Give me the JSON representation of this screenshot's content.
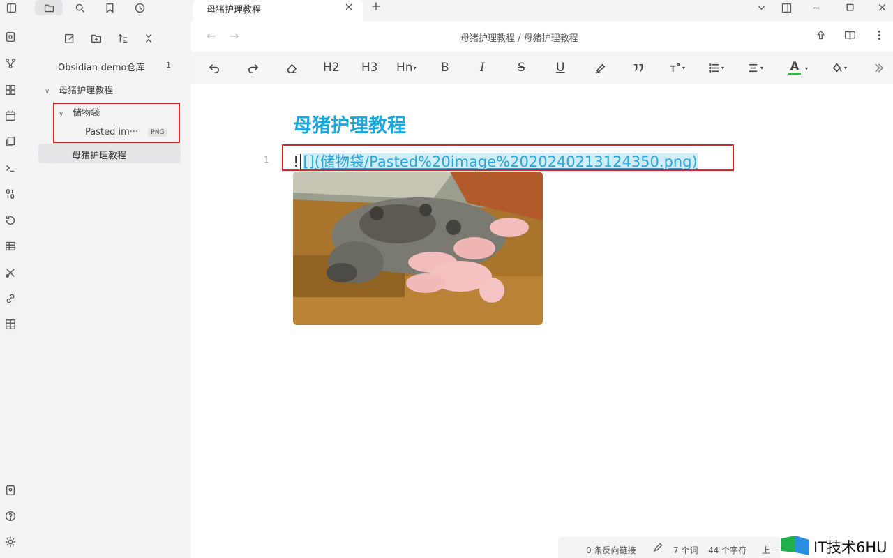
{
  "titlebar": {
    "tab_title": "母猪护理教程",
    "icons": [
      "sidebar-toggle-icon",
      "folder-icon",
      "search-icon",
      "bookmark-icon",
      "clock-icon",
      "close-icon",
      "plus-icon",
      "chevron-down-icon",
      "split-view-icon",
      "minimize-icon",
      "maximize-icon",
      "window-close-icon"
    ]
  },
  "ribbon": {
    "icons": [
      "vault-switch-icon",
      "graph-icon",
      "canvas-icon",
      "calendar-icon",
      "files-icon",
      "terminal-icon",
      "binary-icon",
      "history-icon",
      "table-icon",
      "tools-icon",
      "link-icon",
      "grid-icon",
      "help-vault-icon",
      "help-icon",
      "settings-icon"
    ]
  },
  "sidebar": {
    "vault_name": "Obsidian-demo仓库",
    "vault_count": "1",
    "folder": "母猪护理教程",
    "subfolder": "储物袋",
    "attachment_name": "Pasted im···",
    "attachment_badge": "PNG",
    "active_file": "母猪护理教程"
  },
  "editor": {
    "breadcrumb": "母猪护理教程 / 母猪护理教程",
    "toolbar": {
      "h2": "H2",
      "h3": "H3",
      "hn": "Hn",
      "bold": "B",
      "italic": "I",
      "strike": "S",
      "underline": "U",
      "text_color": "A"
    },
    "note_title": "母猪护理教程",
    "line_number": "1",
    "embed_prefix": "!",
    "embed_link": "[](储物袋/Pasted%20image%2020240213124350.png)"
  },
  "statusbar": {
    "backlinks": "0 条反向链接",
    "words": "7 个词",
    "chars": "44 个字符",
    "extra": "上一"
  },
  "watermark": {
    "text": "IT技术6HU"
  },
  "colors": {
    "accent_title": "#1aa7d9",
    "link": "#2aa6df",
    "highlight_box": "#e02424"
  }
}
